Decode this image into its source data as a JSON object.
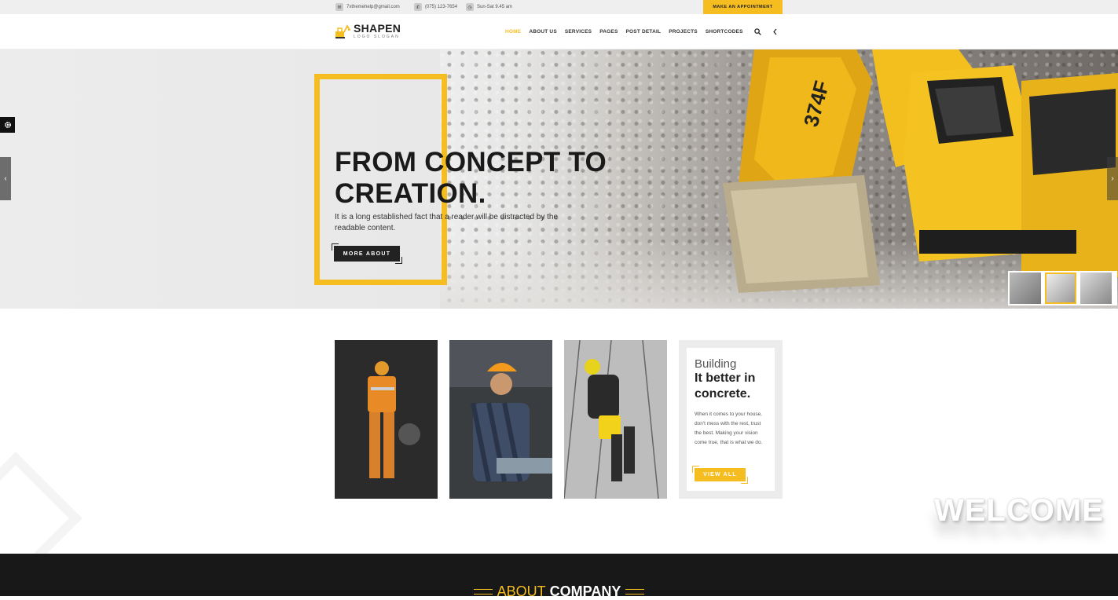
{
  "topbar": {
    "email": "7xthemehelp@gmail.com",
    "phone": "(075) 123-7654",
    "hours": "Sun-Sat 9.45 am",
    "appointment_label": "MAKE AN APPOINTMENT"
  },
  "header": {
    "logo_name": "SHAPEN",
    "logo_slogan": "LOGO SLOGAN",
    "nav": [
      "HOME",
      "ABOUT US",
      "SERVICES",
      "PAGES",
      "POST DETAIL",
      "PROJECTS",
      "SHORTCODES"
    ],
    "active_nav": "HOME"
  },
  "hero": {
    "title_line1": "FROM CONCEPT TO",
    "title_line2": "CREATION.",
    "text": "It is a long established fact that a reader will be distracted by the readable content.",
    "button_label": "MORE ABOUT",
    "excavator_label": "374F"
  },
  "promo": {
    "kicker": "Building",
    "title": "It better in concrete.",
    "text": "When it comes to your house, don't mess with the rest, trust the best. Making your vision come true, that is what we do.",
    "button_label": "VIEW ALL"
  },
  "welcome_text": "WELCOME",
  "about": {
    "light": "ABOUT",
    "bold": "COMPANY"
  },
  "colors": {
    "accent": "#f5bd1f",
    "dark": "#181818"
  }
}
